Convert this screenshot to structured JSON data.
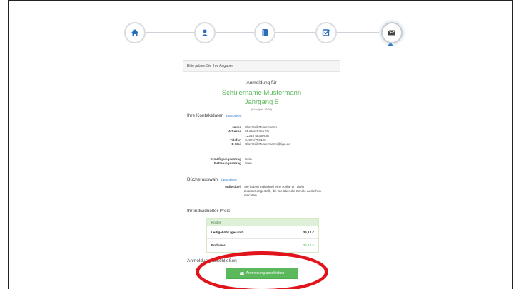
{
  "stepper": {
    "steps": [
      {
        "icon": "home-icon"
      },
      {
        "icon": "user-icon"
      },
      {
        "icon": "book-icon"
      },
      {
        "icon": "check-square-icon"
      },
      {
        "icon": "envelope-icon",
        "active": true
      }
    ],
    "accent": "#2f7dc9"
  },
  "panel": {
    "header": "Bitte prüfen Sie Ihre Angaben",
    "anmeldung_fuer": "Anmeldung für",
    "student_name": "Schülername Mustermann",
    "grade": "Jahrgang 5",
    "gruppe": "(Schuljahr 19/20)",
    "contact": {
      "title": "Ihre Kontaktdaten",
      "edit": "bearbeiten",
      "rows": [
        {
          "label": "Name",
          "value": "Elternteil Mustermann"
        },
        {
          "label": "Adresse",
          "value": "Musterstraße 19"
        },
        {
          "label": "",
          "value": "12345 Musterort"
        },
        {
          "label": "Telefon",
          "value": "04071/789123"
        },
        {
          "label": "E-Mail",
          "value": "Elternteil.Mustermann@rige.de"
        }
      ],
      "extra_rows": [
        {
          "label": "Ermäßigungsantrag",
          "value": "Nein"
        },
        {
          "label": "Befreiungsantrag",
          "value": "Nein"
        }
      ]
    },
    "books": {
      "title": "Bücherauswahl",
      "edit": "bearbeiten",
      "label": "Individuell",
      "text_line1": "Sie haben individuell eine Reihe an Titeln",
      "text_line2": "zusammengestellt, die Sie über die Schule ausleihen",
      "text_line3": "möchten"
    },
    "price": {
      "title": "Ihr individueller Preis",
      "head": "Kosten",
      "rows": [
        {
          "label": "Leihgebühr (gesamt)",
          "value": "36,14 €"
        },
        {
          "label": "Endpreis",
          "value": "36,14 €"
        }
      ]
    },
    "finish": {
      "title": "Anmeldung abschließen",
      "button": "Anmeldung abschicken"
    }
  },
  "colors": {
    "green": "#5cb85c",
    "highlight": "#e1141b"
  }
}
